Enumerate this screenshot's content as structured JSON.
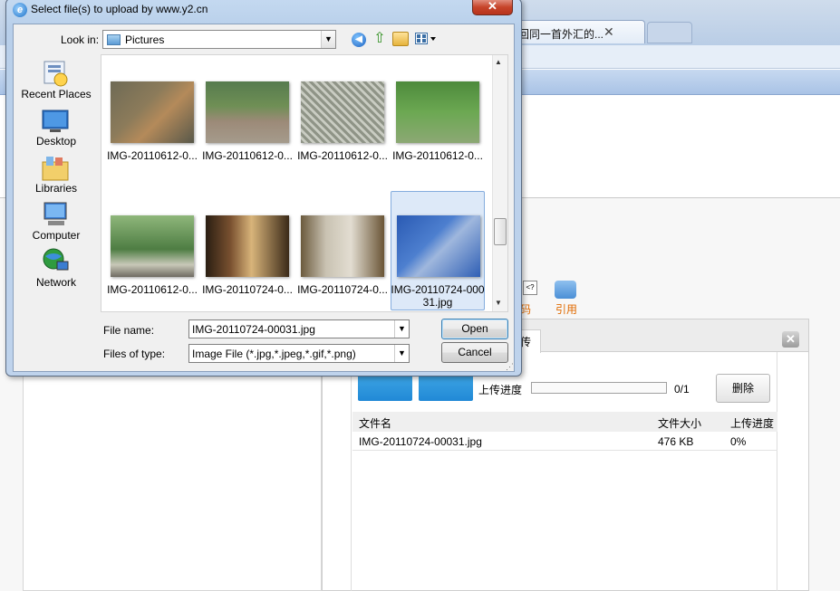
{
  "dialog": {
    "title": "Select file(s) to upload by www.y2.cn",
    "close_glyph": "✕",
    "look_in_label": "Look in:",
    "look_in_value": "Pictures",
    "places": [
      {
        "label": "Recent Places",
        "icon": "recent-places-icon"
      },
      {
        "label": "Desktop",
        "icon": "desktop-icon"
      },
      {
        "label": "Libraries",
        "icon": "libraries-icon"
      },
      {
        "label": "Computer",
        "icon": "computer-icon"
      },
      {
        "label": "Network",
        "icon": "network-icon"
      }
    ],
    "files": [
      {
        "label": "IMG-20110612-0...",
        "selected": false
      },
      {
        "label": "IMG-20110612-0...",
        "selected": false
      },
      {
        "label": "IMG-20110612-0...",
        "selected": false
      },
      {
        "label": "IMG-20110612-0...",
        "selected": false
      },
      {
        "label": "IMG-20110612-0...",
        "selected": false
      },
      {
        "label": "IMG-20110724-0...",
        "selected": false
      },
      {
        "label": "IMG-20110724-0...",
        "selected": false
      },
      {
        "label": "IMG-20110724-000 31.jpg",
        "selected": true
      }
    ],
    "file_name_label": "File name:",
    "file_name_value": "IMG-20110724-00031.jpg",
    "file_type_label": "Files of type:",
    "file_type_value": "Image File (*.jpg,*.jpeg,*.gif,*.png)",
    "open_label": "Open",
    "cancel_label": "Cancel"
  },
  "browser": {
    "tab_title": "回同一首外汇的...",
    "tab_close_glyph": "✕"
  },
  "editor": {
    "code_label": "码",
    "quote_label": "引用"
  },
  "uploader": {
    "tab_label": "传",
    "close_glyph": "✕",
    "progress_label": "上传进度",
    "progress_fraction": 0,
    "progress_count": "0/1",
    "delete_label": "删除",
    "columns": [
      "文件名",
      "文件大小",
      "上传进度"
    ],
    "rows": [
      {
        "name": "IMG-20110724-00031.jpg",
        "size": "476 KB",
        "progress": "0%"
      }
    ]
  }
}
